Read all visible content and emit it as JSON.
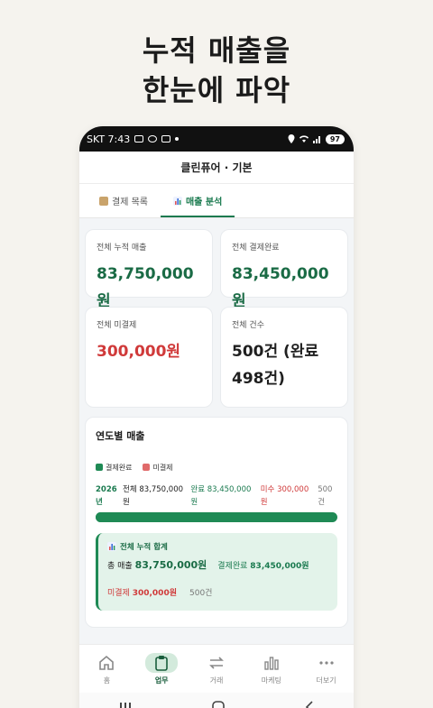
{
  "headline": {
    "line1": "누적 매출을",
    "line2": "한눈에 파악"
  },
  "status_bar": {
    "carrier_time": "SKT 7:43",
    "battery": "97"
  },
  "app_bar": {
    "title": "클린퓨어 · 기본"
  },
  "tabs": [
    {
      "label": "결제 목록",
      "icon": "clipboard-icon",
      "active": false
    },
    {
      "label": "매출 분석",
      "icon": "bar-chart-icon",
      "active": true
    }
  ],
  "stats": {
    "total_sales": {
      "label": "전체 누적 매출",
      "value": "83,750,000원"
    },
    "total_paid": {
      "label": "전체 결제완료",
      "value": "83,450,000원"
    },
    "total_unpaid": {
      "label": "전체 미결제",
      "value": "300,000원"
    },
    "total_count": {
      "label": "전체 건수",
      "value": "500건 (완료 498건)"
    }
  },
  "yearly": {
    "title": "연도별 매출",
    "legend": {
      "paid": "결제완료",
      "unpaid": "미결제"
    },
    "colors": {
      "paid": "#1f8a55",
      "unpaid": "#e06a6a"
    },
    "rows": [
      {
        "year": "2026년",
        "total": "전체 83,750,000원",
        "paid": "완료 83,450,000원",
        "unpaid": "미수 300,000원",
        "count": "500건",
        "paid_ratio": 0.996
      }
    ],
    "summary": {
      "title": "전체 누적 합계",
      "total_label": "총 매출",
      "total_value": "83,750,000원",
      "paid_label": "결제완료",
      "paid_value": "83,450,000원",
      "unpaid_label": "미결제",
      "unpaid_value": "300,000원",
      "count": "500건"
    }
  },
  "bottom_nav": [
    {
      "label": "홈",
      "icon": "home-icon"
    },
    {
      "label": "업무",
      "icon": "clipboard-icon",
      "active": true
    },
    {
      "label": "거래",
      "icon": "swap-icon"
    },
    {
      "label": "마케팅",
      "icon": "bar-chart-icon"
    },
    {
      "label": "더보기",
      "icon": "more-icon"
    }
  ]
}
